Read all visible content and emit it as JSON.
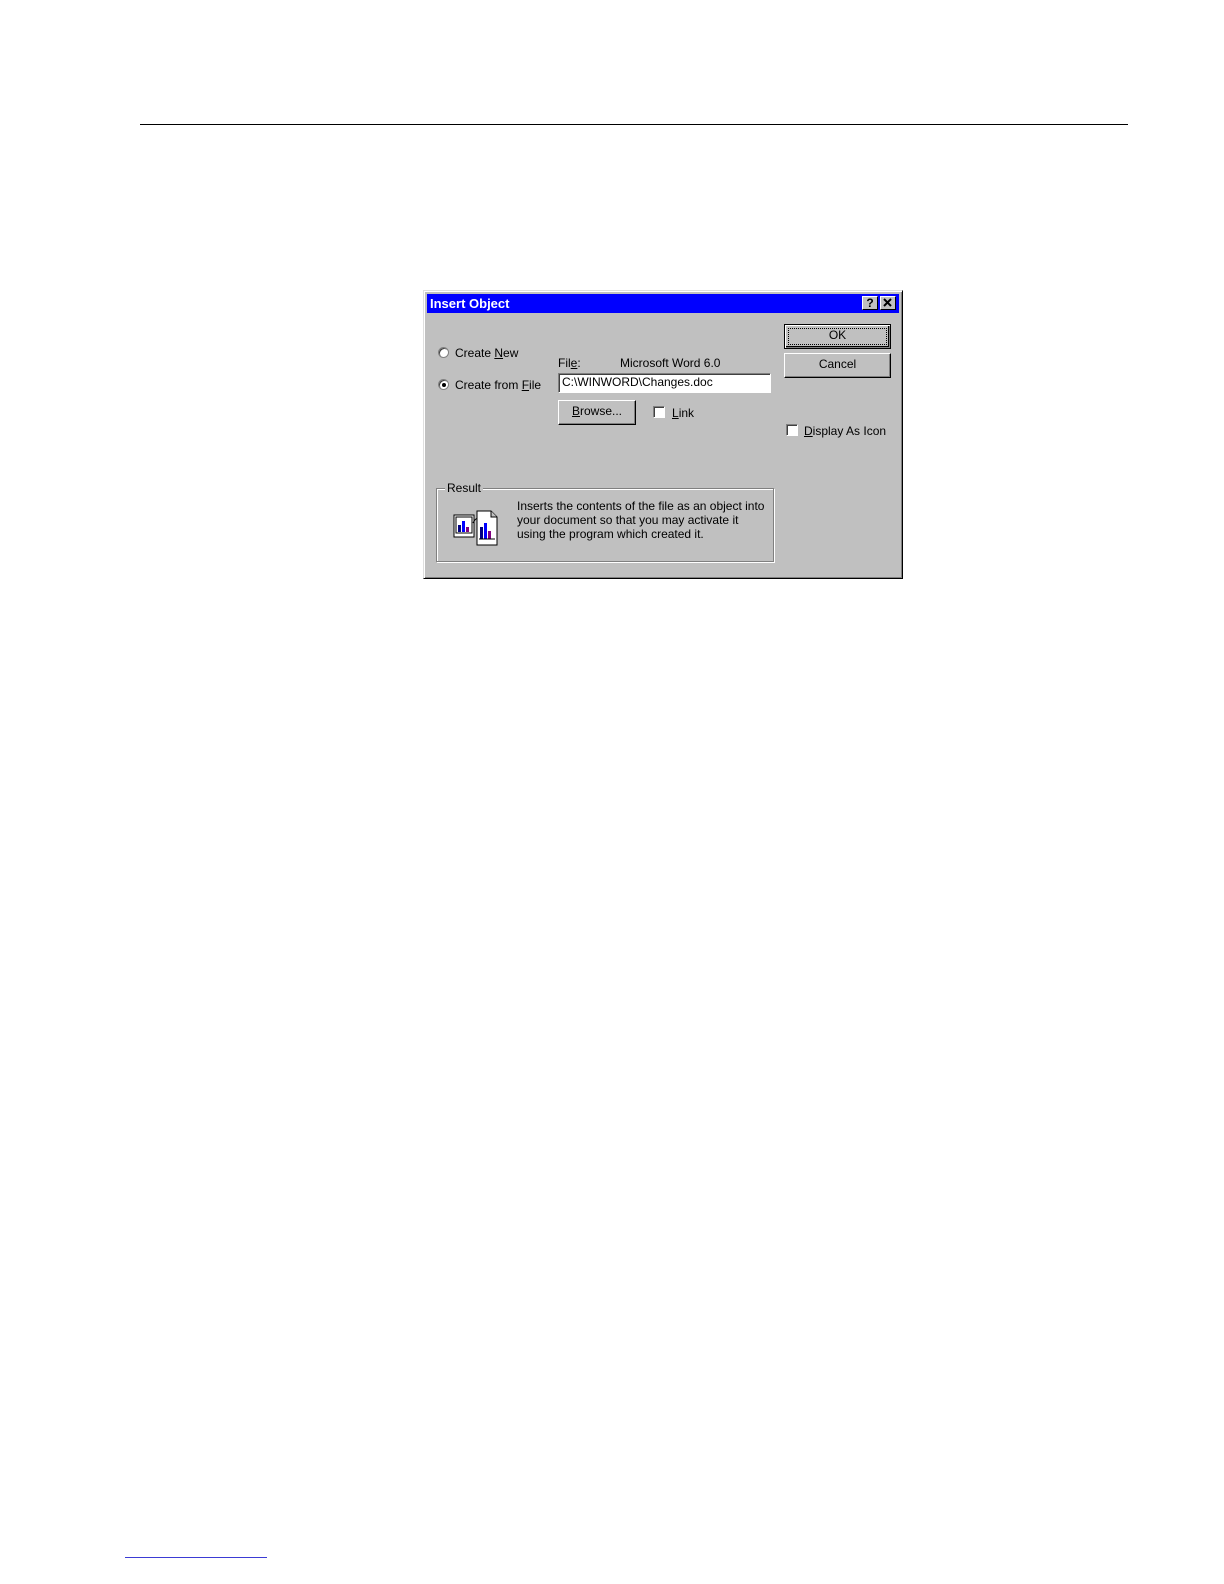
{
  "dialog": {
    "title": "Insert Object",
    "help_label": "?",
    "close_label": "✕",
    "radio_create_new": {
      "pre": "Create ",
      "accel": "N",
      "post": "ew",
      "selected": false
    },
    "radio_create_from_file": {
      "pre": "Create from ",
      "accel": "F",
      "post": "ile",
      "selected": true
    },
    "file_label": {
      "pre": "Fil",
      "accel": "e",
      "post": ":"
    },
    "file_type": "Microsoft Word 6.0",
    "file_path": "C:\\WINWORD\\Changes.doc",
    "browse_button": {
      "accel": "B",
      "post": "rowse..."
    },
    "link_checkbox": {
      "accel": "L",
      "post": "ink",
      "checked": false
    },
    "ok_button": "OK",
    "cancel_button": "Cancel",
    "display_as_icon": {
      "accel": "D",
      "post": "isplay As Icon",
      "checked": false
    },
    "result": {
      "title": "Result",
      "text": "Inserts the contents of the file as an object into your document so that you may activate it using the program which created it.",
      "icon": "insert-object-result-icon"
    }
  },
  "colors": {
    "titlebar": "#0000ff",
    "face": "#c0c0c0"
  }
}
